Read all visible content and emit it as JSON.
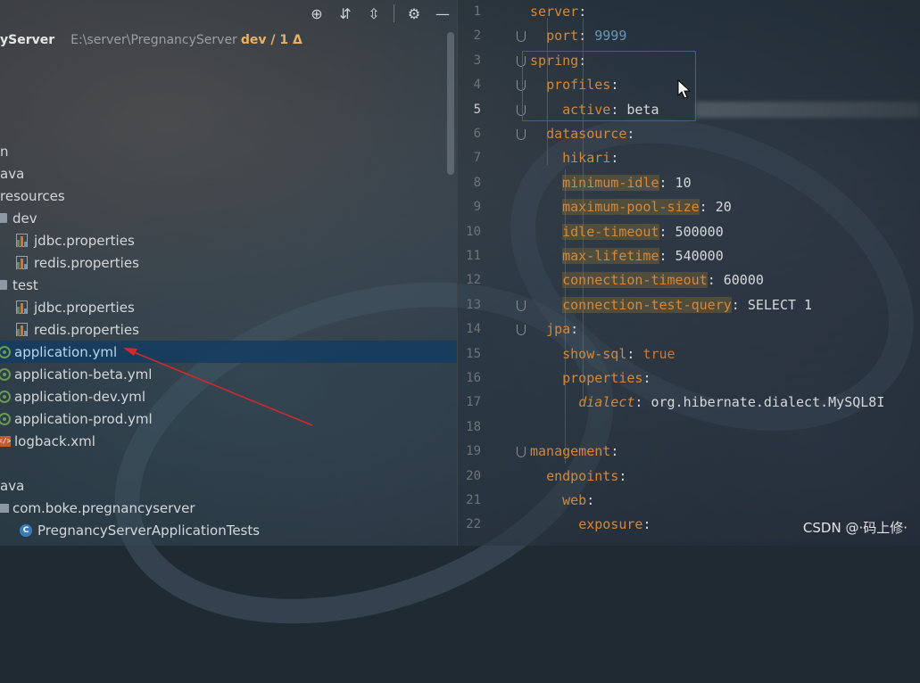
{
  "toolbar": {
    "icons": [
      "locate-icon",
      "expand-all-icon",
      "collapse-all-icon",
      "gear-icon",
      "minimize-icon"
    ]
  },
  "project": {
    "root_name": "yServer",
    "root_path": "E:\\server\\PregnancyServer",
    "vcs_status": "dev / 1 Δ"
  },
  "tree": [
    {
      "label": "n",
      "type": "folder-partial"
    },
    {
      "label": "ava",
      "type": "folder-partial"
    },
    {
      "label": "resources",
      "type": "folder-partial"
    },
    {
      "label": "dev",
      "type": "folder"
    },
    {
      "label": "jdbc.properties",
      "type": "properties"
    },
    {
      "label": "redis.properties",
      "type": "properties"
    },
    {
      "label": "test",
      "type": "folder"
    },
    {
      "label": "jdbc.properties",
      "type": "properties"
    },
    {
      "label": "redis.properties",
      "type": "properties"
    },
    {
      "label": "application.yml",
      "type": "yml",
      "selected": true
    },
    {
      "label": "application-beta.yml",
      "type": "yml"
    },
    {
      "label": "application-dev.yml",
      "type": "yml"
    },
    {
      "label": "application-prod.yml",
      "type": "yml"
    },
    {
      "label": "logback.xml",
      "type": "xml"
    },
    {
      "label": "ava",
      "type": "folder-partial"
    },
    {
      "label": "com.boke.pregnancyserver",
      "type": "package"
    },
    {
      "label": "PregnancyServerApplicationTests",
      "type": "class"
    }
  ],
  "editor": {
    "current_line": 5,
    "lines": [
      {
        "n": "1",
        "parts": [
          [
            "k",
            "server"
          ],
          [
            "plain",
            ":"
          ]
        ]
      },
      {
        "n": "2",
        "parts": [
          [
            "plain",
            "  "
          ],
          [
            "k",
            "port"
          ],
          [
            "plain",
            ": "
          ],
          [
            "num",
            "9999"
          ]
        ]
      },
      {
        "n": "3",
        "parts": [
          [
            "k",
            "spring"
          ],
          [
            "plain",
            ":"
          ]
        ]
      },
      {
        "n": "4",
        "parts": [
          [
            "plain",
            "  "
          ],
          [
            "k",
            "profiles"
          ],
          [
            "plain",
            ":"
          ]
        ]
      },
      {
        "n": "5",
        "parts": [
          [
            "plain",
            "    "
          ],
          [
            "k",
            "active"
          ],
          [
            "plain",
            ": beta"
          ]
        ]
      },
      {
        "n": "6",
        "parts": [
          [
            "plain",
            "  "
          ],
          [
            "k",
            "datasource"
          ],
          [
            "plain",
            ":"
          ]
        ]
      },
      {
        "n": "7",
        "parts": [
          [
            "plain",
            "    "
          ],
          [
            "k",
            "hikari"
          ],
          [
            "plain",
            ":"
          ]
        ]
      },
      {
        "n": "8",
        "parts": [
          [
            "plain",
            "    "
          ],
          [
            "k-hl",
            "minimum-idle"
          ],
          [
            "plain",
            ": 10"
          ]
        ]
      },
      {
        "n": "9",
        "parts": [
          [
            "plain",
            "    "
          ],
          [
            "k-hl",
            "maximum-pool-size"
          ],
          [
            "plain",
            ": 20"
          ]
        ]
      },
      {
        "n": "10",
        "parts": [
          [
            "plain",
            "    "
          ],
          [
            "k-hl",
            "idle-timeout"
          ],
          [
            "plain",
            ": 500000"
          ]
        ]
      },
      {
        "n": "11",
        "parts": [
          [
            "plain",
            "    "
          ],
          [
            "k-hl",
            "max-lifetime"
          ],
          [
            "plain",
            ": 540000"
          ]
        ]
      },
      {
        "n": "12",
        "parts": [
          [
            "plain",
            "    "
          ],
          [
            "k-hl",
            "connection-timeout"
          ],
          [
            "plain",
            ": 60000"
          ]
        ]
      },
      {
        "n": "13",
        "parts": [
          [
            "plain",
            "    "
          ],
          [
            "k-hl",
            "connection-test-query"
          ],
          [
            "plain",
            ": SELECT 1"
          ]
        ]
      },
      {
        "n": "14",
        "parts": [
          [
            "plain",
            "  "
          ],
          [
            "k",
            "jpa"
          ],
          [
            "plain",
            ":"
          ]
        ]
      },
      {
        "n": "15",
        "parts": [
          [
            "plain",
            "    "
          ],
          [
            "k",
            "show-sql"
          ],
          [
            "plain",
            ": "
          ],
          [
            "bool",
            "true"
          ]
        ]
      },
      {
        "n": "16",
        "parts": [
          [
            "plain",
            "    "
          ],
          [
            "k",
            "properties"
          ],
          [
            "plain",
            ":"
          ]
        ]
      },
      {
        "n": "17",
        "parts": [
          [
            "plain",
            "      "
          ],
          [
            "ital",
            "dialect"
          ],
          [
            "plain",
            ": org.hibernate.dialect.MySQL8I"
          ]
        ]
      },
      {
        "n": "18",
        "parts": []
      },
      {
        "n": "19",
        "parts": [
          [
            "k",
            "management"
          ],
          [
            "plain",
            ":"
          ]
        ]
      },
      {
        "n": "20",
        "parts": [
          [
            "plain",
            "  "
          ],
          [
            "k",
            "endpoints"
          ],
          [
            "plain",
            ":"
          ]
        ]
      },
      {
        "n": "21",
        "parts": [
          [
            "plain",
            "    "
          ],
          [
            "k",
            "web"
          ],
          [
            "plain",
            ":"
          ]
        ]
      },
      {
        "n": "22",
        "parts": [
          [
            "plain",
            "      "
          ],
          [
            "k",
            "exposure"
          ],
          [
            "plain",
            ":"
          ]
        ]
      }
    ]
  },
  "watermark": "CSDN @·码上修·",
  "colors": {
    "keyword": "#d4883a",
    "number": "#6897bb",
    "selection": "#143c5f",
    "annotation_red": "#d9262b"
  }
}
